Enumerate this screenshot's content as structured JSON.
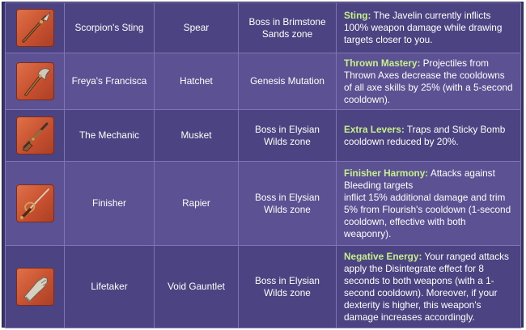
{
  "rows": [
    {
      "icon": "spear-icon",
      "name": "Scorpion's Sting",
      "type": "Spear",
      "source": "Boss in Brimstone Sands zone",
      "perk_name": "Sting:",
      "perk_text": " The Javelin currently inflicts 100% weapon damage while drawing targets closer to you."
    },
    {
      "icon": "hatchet-icon",
      "name": "Freya's Francisca",
      "type": "Hatchet",
      "source": "Genesis Mutation",
      "perk_name": "Thrown Mastery:",
      "perk_text": " Projectiles from Thrown Axes decrease the cooldowns of all axe skills by 25% (with a 5-second cooldown)."
    },
    {
      "icon": "musket-icon",
      "name": "The Mechanic",
      "type": "Musket",
      "source": "Boss in Elysian Wilds zone",
      "perk_name": "Extra Levers:",
      "perk_text": " Traps and Sticky Bomb cooldown reduced by 20%."
    },
    {
      "icon": "rapier-icon",
      "name": "Finisher",
      "type": "Rapier",
      "source": "Boss in Elysian Wilds zone",
      "perk_name": "Finisher Harmony:",
      "perk_text": " Attacks against Bleeding targets\ninflict 15% additional damage and trim 5% from Flourish's cooldown (1-second cooldown, effective with both weaponry)."
    },
    {
      "icon": "gauntlet-icon",
      "name": "Lifetaker",
      "type": "Void Gauntlet",
      "source": "Boss in Elysian Wilds zone",
      "perk_name": "Negative Energy:",
      "perk_text": " Your ranged attacks apply the Disintegrate effect for 8 seconds to both weapons (with a 1-second cooldown). Moreover, if your dexterity is higher, this weapon's damage increases accordingly."
    }
  ],
  "colors": {
    "background": "#3a3366",
    "row_dark": "#4c4382",
    "row_light": "#5b5193",
    "border": "#7f75b4",
    "perk_name": "#c6f08a",
    "icon_bg": "#d15a35"
  }
}
